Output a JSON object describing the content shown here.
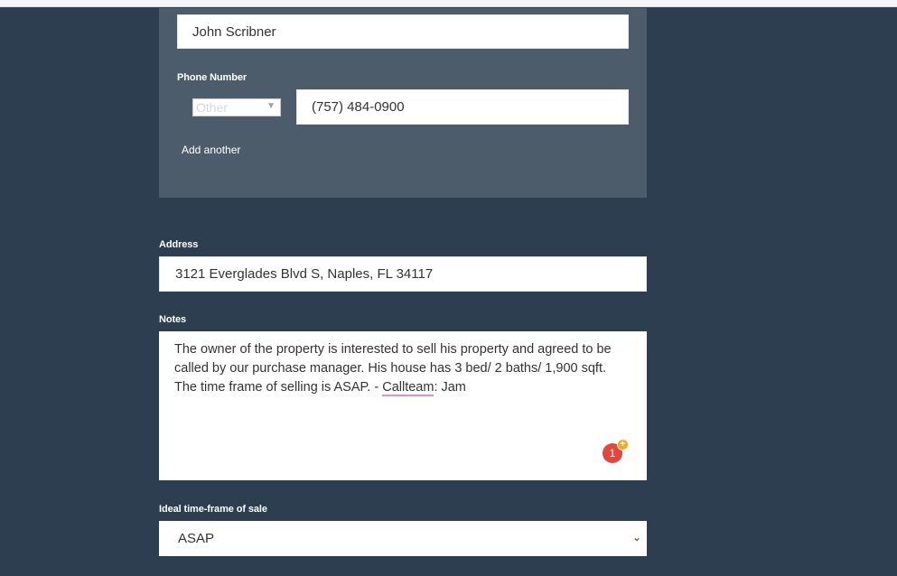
{
  "contact": {
    "name_value": "John Scribner",
    "phone_label": "Phone Number",
    "phone_type": "Other",
    "phone_value": "(757) 484-0900",
    "add_another": "Add another"
  },
  "address": {
    "label": "Address",
    "value": "3121 Everglades Blvd S, Naples, FL 34117"
  },
  "notes": {
    "label": "Notes",
    "text_before": "The owner of the property is interested to sell his property and agreed to be called by our purchase manager. His house has 3 bed/ 2 baths/ 1,900 sqft. The time frame of selling is ASAP. - ",
    "misspelled": "Callteam",
    "text_after": ": Jam",
    "badge_count": "1",
    "badge_plus": "+"
  },
  "timeframe": {
    "label": "Ideal time-frame of sale",
    "selected": "ASAP"
  },
  "icons": {
    "select_chevron": "chevron-down-icon"
  },
  "colors": {
    "background": "#2c3e50",
    "panel": "#4d5c6b",
    "badge": "#e3463a",
    "badge_plus": "#f5a623"
  }
}
